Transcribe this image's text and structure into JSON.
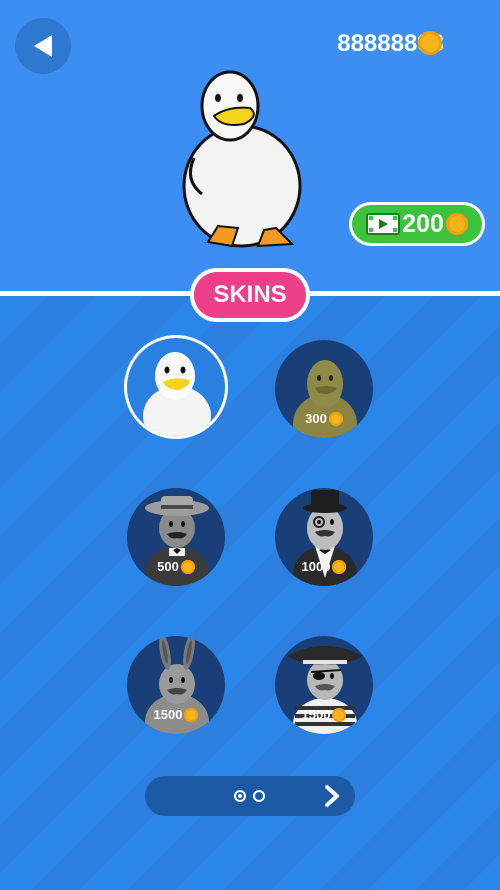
{
  "header": {
    "coin_total": "88888893",
    "icons": {
      "back": "back-arrow-icon",
      "coin": "coin-icon",
      "video": "video-ad-icon"
    }
  },
  "ad_reward": {
    "amount": "200"
  },
  "section": {
    "title": "SKINS"
  },
  "skins": [
    {
      "name": "white-duck",
      "price": "",
      "selected": true
    },
    {
      "name": "olive-duck",
      "price": "300",
      "selected": false
    },
    {
      "name": "gangster-duck",
      "price": "500",
      "selected": false
    },
    {
      "name": "gentleman-duck",
      "price": "1000",
      "selected": false
    },
    {
      "name": "bunny-duck",
      "price": "1500",
      "selected": false
    },
    {
      "name": "pirate-duck",
      "price": "1500",
      "selected": false
    }
  ],
  "pager": {
    "page": 1,
    "pages": 2
  },
  "colors": {
    "sky": "#3d8ef3",
    "skins_badge": "#ef3f8a",
    "ad_button": "#3cc23c",
    "coin": "#f7b51b",
    "skin_slot": "#1a3f78"
  }
}
